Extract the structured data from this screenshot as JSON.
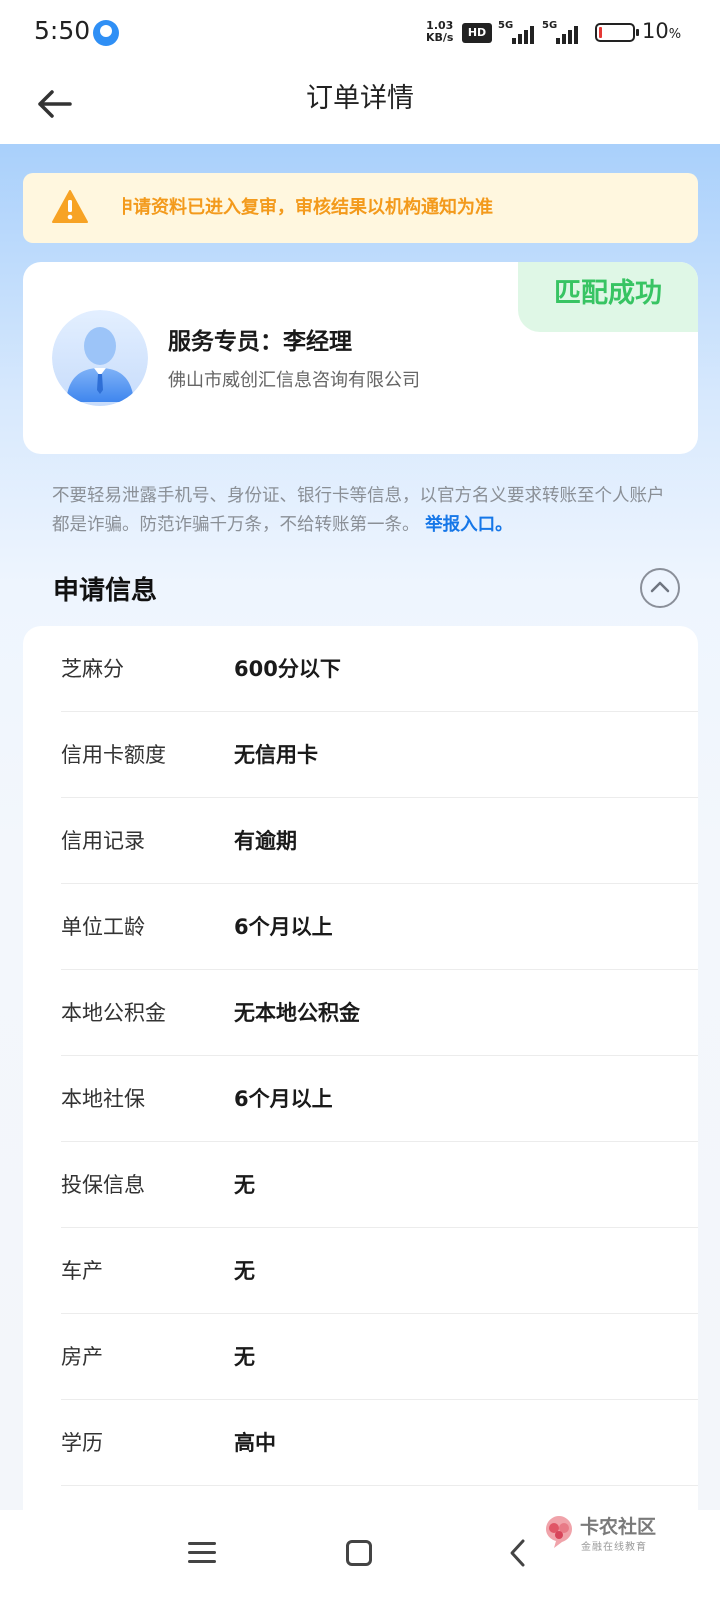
{
  "status_bar": {
    "time": "5:50",
    "net_speed_value": "1.03",
    "net_speed_unit": "KB/s",
    "hd": "HD",
    "signal1": "5G",
    "signal2": "5G",
    "battery_text": "10",
    "battery_unit": "%",
    "battery_level": 0.1
  },
  "header": {
    "title": "订单详情"
  },
  "notice": {
    "text": "款申请资料已进入复审，审核结果以机构通知为准"
  },
  "agent": {
    "badge": "匹配成功",
    "name": "服务专员：李经理",
    "company": "佛山市威创汇信息咨询有限公司"
  },
  "warning": {
    "text": "不要轻易泄露手机号、身份证、银行卡等信息，以官方名义要求转账至个人账户都是诈骗。防范诈骗千万条，不给转账第一条。",
    "link": "举报入口。"
  },
  "section": {
    "title": "申请信息"
  },
  "info": {
    "rows": [
      {
        "label": "芝麻分",
        "value": "600分以下"
      },
      {
        "label": "信用卡额度",
        "value": "无信用卡"
      },
      {
        "label": "信用记录",
        "value": "有逾期"
      },
      {
        "label": "单位工龄",
        "value": "6个月以上"
      },
      {
        "label": "本地公积金",
        "value": "无本地公积金"
      },
      {
        "label": "本地社保",
        "value": "6个月以上"
      },
      {
        "label": "投保信息",
        "value": "无"
      },
      {
        "label": "车产",
        "value": "无"
      },
      {
        "label": "房产",
        "value": "无"
      },
      {
        "label": "学历",
        "value": "高中"
      }
    ]
  },
  "watermark": {
    "title": "卡农社区",
    "subtitle": "金融在线教育"
  },
  "colors": {
    "notice_text": "#f39a1c",
    "match_green": "#38c463",
    "link_blue": "#1677e8"
  }
}
